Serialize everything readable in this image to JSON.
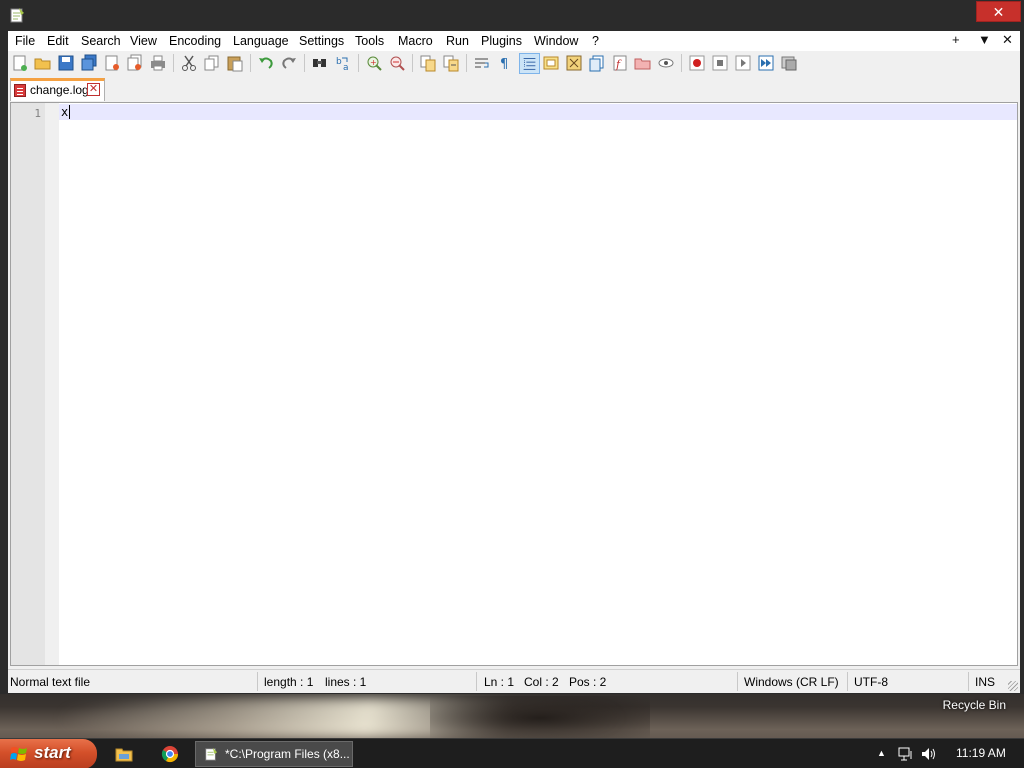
{
  "menu": {
    "items": [
      "File",
      "Edit",
      "Search",
      "View",
      "Encoding",
      "Language",
      "Settings",
      "Tools",
      "Macro",
      "Run",
      "Plugins",
      "Window",
      "?"
    ],
    "right_plus": "+",
    "right_arrow": "▼",
    "right_close": "✕"
  },
  "window": {
    "close_glyph": "✕"
  },
  "tab": {
    "label": "change.log",
    "close_glyph": "✕"
  },
  "editor": {
    "line_number": "1",
    "line_text": "x"
  },
  "status": {
    "file_type": "Normal text file",
    "length": "length : 1",
    "lines": "lines : 1",
    "ln": "Ln : 1",
    "col": "Col : 2",
    "pos": "Pos : 2",
    "eol": "Windows (CR LF)",
    "encoding": "UTF-8",
    "mode": "INS"
  },
  "desktop": {
    "recycle_bin": "Recycle Bin"
  },
  "taskbar": {
    "start_label": "start",
    "task_label": "*C:\\Program Files (x8...",
    "clock": "11:19 AM"
  },
  "colors": {
    "accent_tab": "#f5a142",
    "close_red": "#c7302b",
    "start_orange": "#d4502a"
  }
}
